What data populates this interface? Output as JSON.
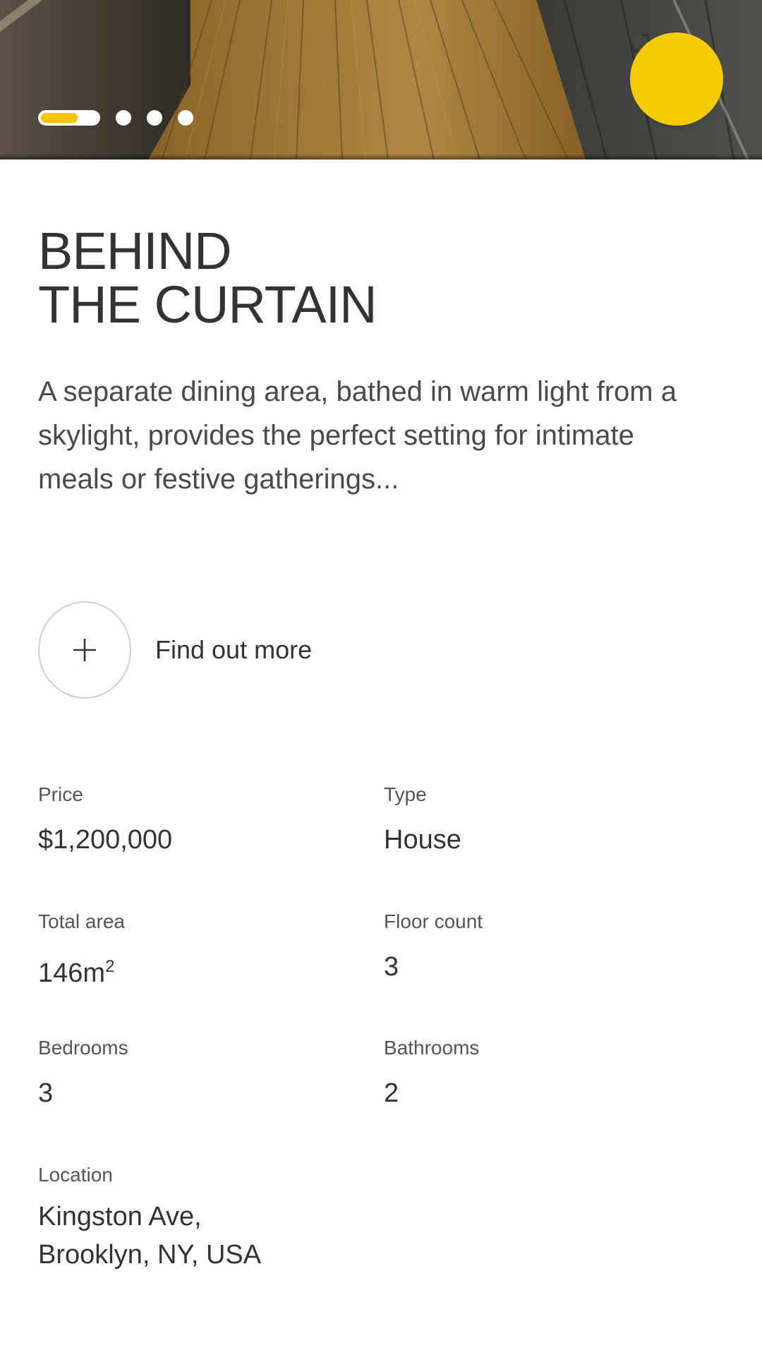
{
  "hero": {
    "image_description_icon": "wood-floor-photo",
    "carousel": {
      "count": 4,
      "active_index": 0
    },
    "expand_icon": "expand-icon",
    "accent_color": "#f7cb06"
  },
  "title_line1": "BEHIND",
  "title_line2": "THE CURTAIN",
  "description": "A separate dining area, bathed in warm light from a skylight, provides the perfect setting for intimate meals or festive gatherings...",
  "find_out_more": {
    "icon": "plus-icon",
    "label": "Find out more"
  },
  "specs": {
    "price": {
      "label": "Price",
      "value": "$1,200,000"
    },
    "type": {
      "label": "Type",
      "value": "House"
    },
    "total_area": {
      "label": "Total area",
      "value": "146m",
      "unit_sup": "2"
    },
    "floor_count": {
      "label": "Floor count",
      "value": "3"
    },
    "bedrooms": {
      "label": "Bedrooms",
      "value": "3"
    },
    "bathrooms": {
      "label": "Bathrooms",
      "value": "2"
    },
    "location": {
      "label": "Location",
      "line1": "Kingston Ave,",
      "line2": "Brooklyn, NY, USA"
    }
  }
}
